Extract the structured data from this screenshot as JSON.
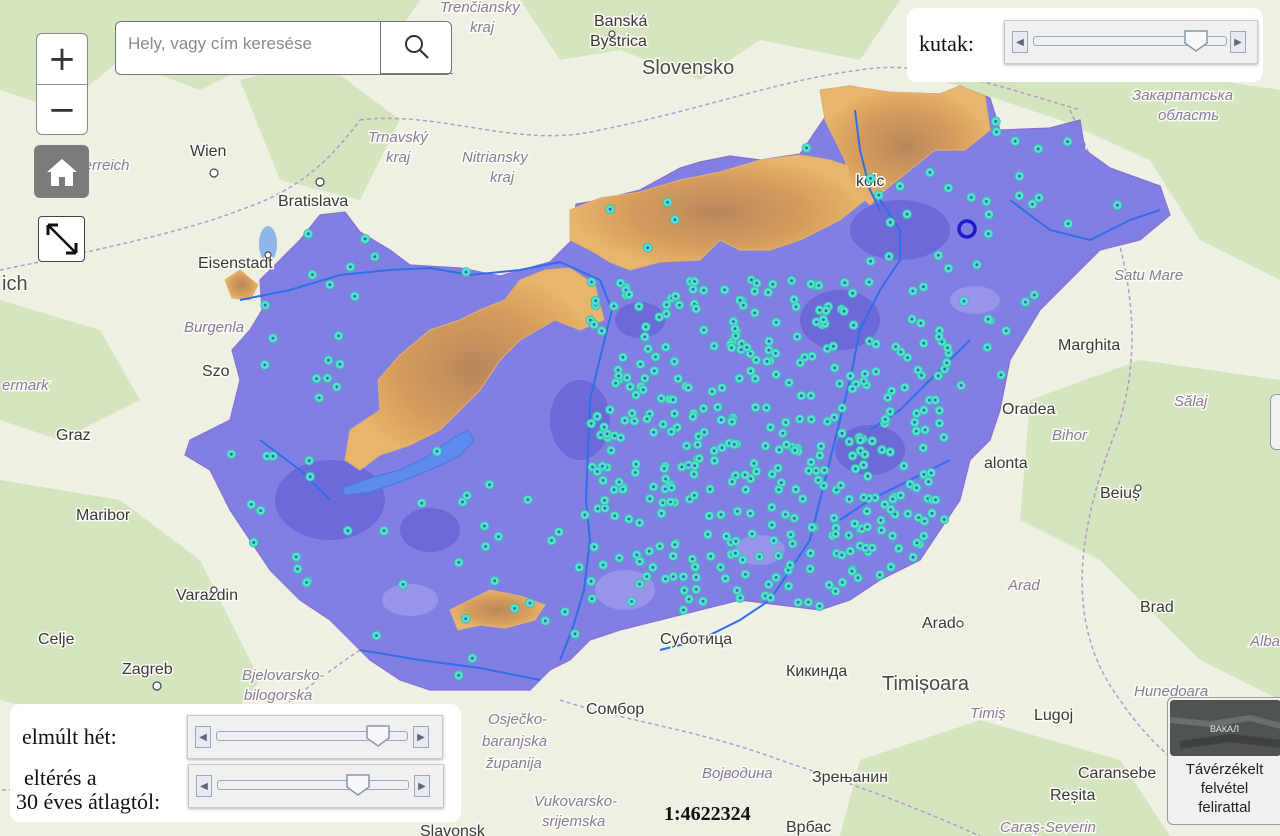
{
  "search": {
    "placeholder": "Hely, vagy cím keresése"
  },
  "controls": {
    "zoom_in": "+",
    "zoom_out": "−",
    "home_icon": "home-icon",
    "fullscreen_icon": "expand-icon",
    "search_icon": "search-icon"
  },
  "sliders": {
    "wells": {
      "label": "kutak:",
      "value": 0.85
    },
    "last_week": {
      "label": "elmúlt hét:",
      "value": 0.85
    },
    "deviation": {
      "label_line1": "eltérés a",
      "label_line2": "30 éves átlagtól:",
      "value": 0.74
    }
  },
  "scale": "1:4622324",
  "basemap_switch": {
    "thumb_text": "ВАКАЛ",
    "line1": "Távérzékelt",
    "line2": "felvétel",
    "line3": "felirattal"
  },
  "places": [
    {
      "name": "Trenčiansky",
      "kind": "region"
    },
    {
      "name": "kraj",
      "kind": "region"
    },
    {
      "name": "Banská",
      "kind": "city"
    },
    {
      "name": "Bystrica",
      "kind": "city"
    },
    {
      "name": "Slovensko",
      "kind": "country"
    },
    {
      "name": "Закарпатська",
      "kind": "region"
    },
    {
      "name": "область",
      "kind": "region"
    },
    {
      "name": "Trnavský",
      "kind": "region"
    },
    {
      "name": "kraj",
      "kind": "region"
    },
    {
      "name": "Nitriansky",
      "kind": "region"
    },
    {
      "name": "kraj",
      "kind": "region"
    },
    {
      "name": "Wien",
      "kind": "city"
    },
    {
      "name": "sterreich",
      "kind": "country"
    },
    {
      "name": "Bratislava",
      "kind": "city"
    },
    {
      "name": "kolc",
      "kind": "city"
    },
    {
      "name": "Eisenstadt",
      "kind": "city"
    },
    {
      "name": "ich",
      "kind": "country"
    },
    {
      "name": "Burgenla",
      "kind": "region"
    },
    {
      "name": "Satu Mare",
      "kind": "region"
    },
    {
      "name": "Marghita",
      "kind": "city"
    },
    {
      "name": "Szo",
      "kind": "city"
    },
    {
      "name": "ermark",
      "kind": "region"
    },
    {
      "name": "Graz",
      "kind": "city"
    },
    {
      "name": "Oradea",
      "kind": "city"
    },
    {
      "name": "Sălaj",
      "kind": "region"
    },
    {
      "name": "Bihor",
      "kind": "region"
    },
    {
      "name": "alonta",
      "kind": "city"
    },
    {
      "name": "Beiuș",
      "kind": "city"
    },
    {
      "name": "Maribor",
      "kind": "city"
    },
    {
      "name": "Arad",
      "kind": "region"
    },
    {
      "name": "Varaždin",
      "kind": "city"
    },
    {
      "name": "Celje",
      "kind": "city"
    },
    {
      "name": "Brad",
      "kind": "city"
    },
    {
      "name": "Arad",
      "kind": "city"
    },
    {
      "name": "Субoтица",
      "kind": "city"
    },
    {
      "name": "Zagreb",
      "kind": "city"
    },
    {
      "name": "Bjelovarsko-",
      "kind": "region"
    },
    {
      "name": "bilogorska",
      "kind": "region"
    },
    {
      "name": "Кикинда",
      "kind": "city"
    },
    {
      "name": "Timișoara",
      "kind": "country"
    },
    {
      "name": "Hunedoara",
      "kind": "region"
    },
    {
      "name": "Alba",
      "kind": "region"
    },
    {
      "name": "Сомбор",
      "kind": "city"
    },
    {
      "name": "Osječko-",
      "kind": "region"
    },
    {
      "name": "baranjska",
      "kind": "region"
    },
    {
      "name": "županija",
      "kind": "region"
    },
    {
      "name": "Timiș",
      "kind": "region"
    },
    {
      "name": "Lugoj",
      "kind": "city"
    },
    {
      "name": "Војводина",
      "kind": "region"
    },
    {
      "name": "Зрењанин",
      "kind": "city"
    },
    {
      "name": "Caransebe",
      "kind": "city"
    },
    {
      "name": "Reșita",
      "kind": "city"
    },
    {
      "name": "Vukovarsko-",
      "kind": "region"
    },
    {
      "name": "srijemska",
      "kind": "region"
    },
    {
      "name": "Врбас",
      "kind": "city"
    },
    {
      "name": "Caraș-Severin",
      "kind": "region"
    },
    {
      "name": "Slavonsk",
      "kind": "city"
    }
  ],
  "colors": {
    "hungary_fill": "#7b78e4",
    "highland": "#d9a25e",
    "well_marker": "#54e3c8",
    "selected_well": "#1c1cc8",
    "river": "#2f6ee8",
    "lake": "#5d8bf0"
  }
}
